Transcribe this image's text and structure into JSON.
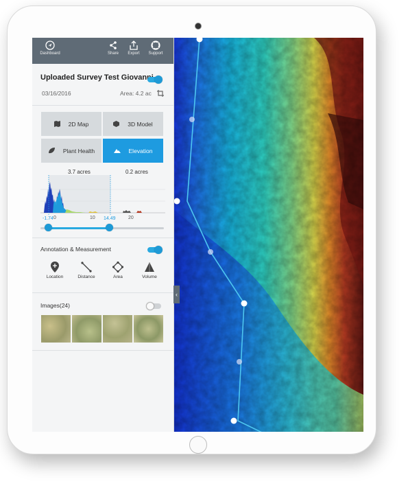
{
  "toolbar": {
    "dashboard_label": "Dashboard",
    "share_label": "Share",
    "export_label": "Export",
    "support_label": "Support"
  },
  "survey": {
    "title": "Uploaded Survey Test Giovanni",
    "date": "03/16/2016",
    "area": "Area: 4.2 ac",
    "visible": true
  },
  "modes": [
    {
      "label": "2D Map",
      "icon": "map-icon",
      "active": false
    },
    {
      "label": "3D Model",
      "icon": "cube-icon",
      "active": false
    },
    {
      "label": "Plant Health",
      "icon": "leaf-icon",
      "active": false
    },
    {
      "label": "Elevation",
      "icon": "mountain-icon",
      "active": true
    }
  ],
  "histogram": {
    "left_acres": "3.7 acres",
    "right_acres": "0.2 acres",
    "ticks": [
      "0",
      "10",
      "20"
    ],
    "range_min": "-1.74",
    "range_max": "14.49"
  },
  "annotation": {
    "label": "Annotation & Measurement",
    "enabled": true,
    "tools": [
      {
        "label": "Location",
        "icon": "location-pin-icon"
      },
      {
        "label": "Distance",
        "icon": "distance-line-icon"
      },
      {
        "label": "Area",
        "icon": "area-polygon-icon"
      },
      {
        "label": "Volume",
        "icon": "volume-pyramid-icon"
      }
    ]
  },
  "images": {
    "label": "Images(24)",
    "enabled": false
  },
  "colors": {
    "accent": "#1e9be0",
    "topbar": "#5f6b76"
  }
}
